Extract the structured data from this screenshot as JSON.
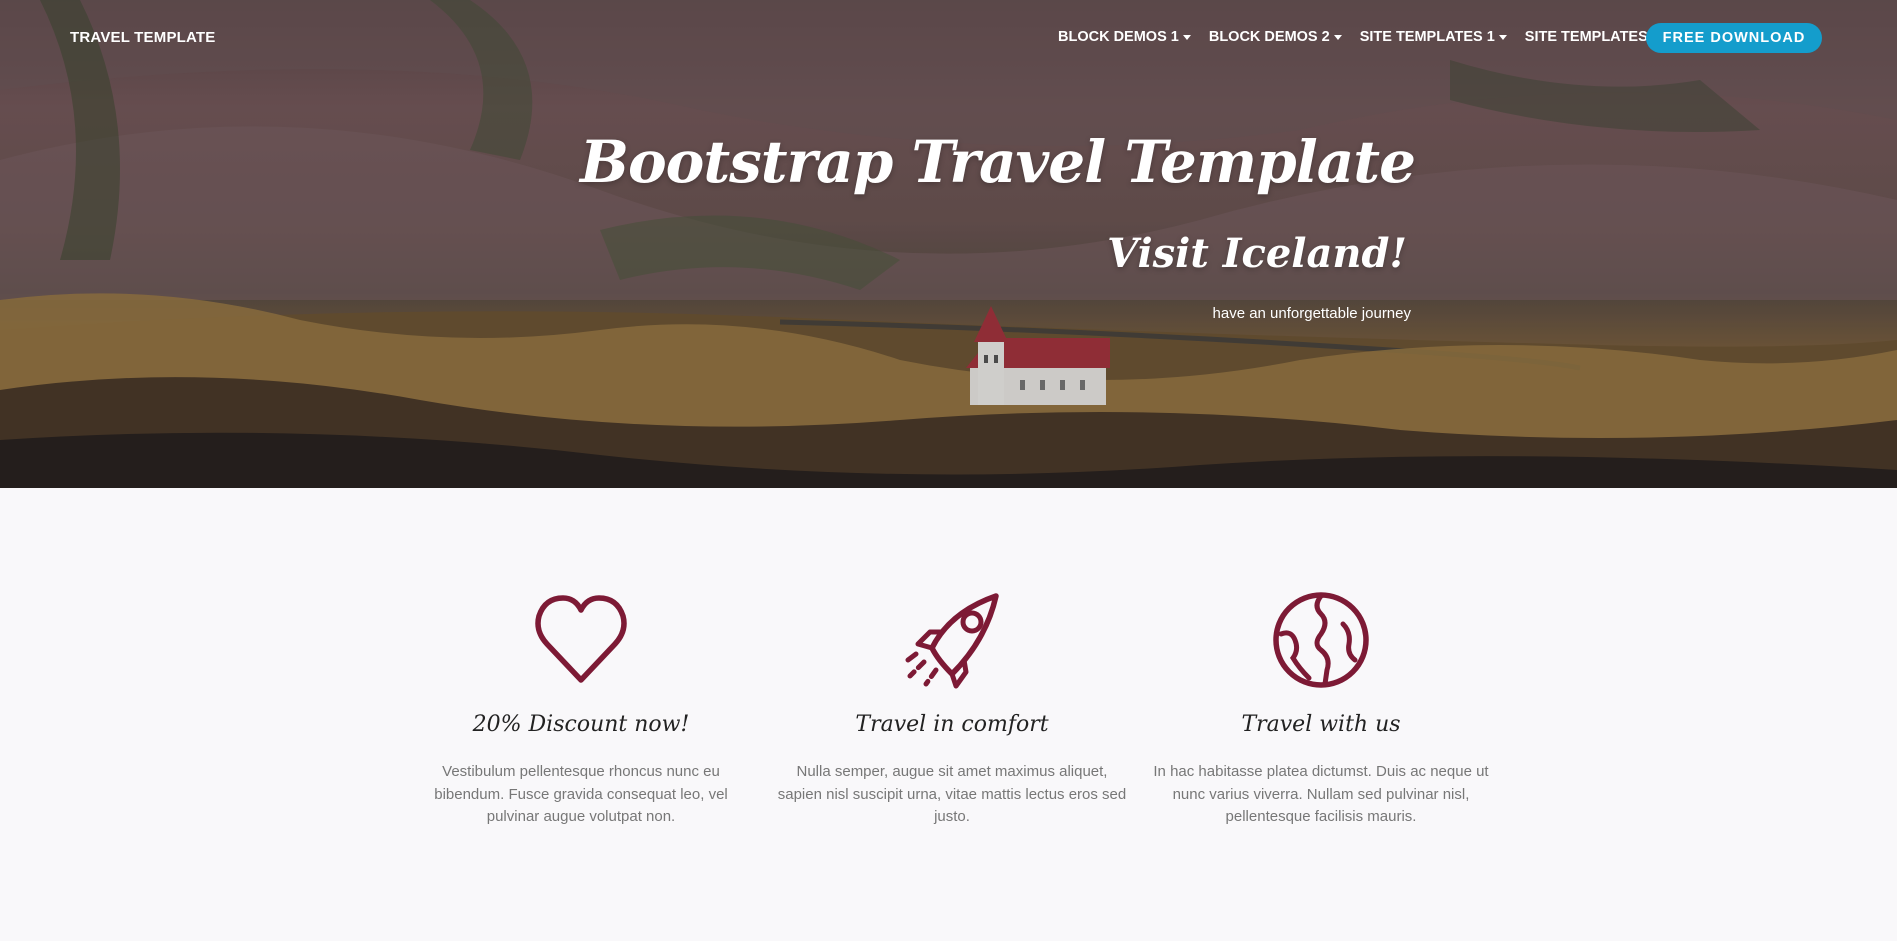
{
  "navbar": {
    "brand": "TRAVEL TEMPLATE",
    "items": [
      {
        "label": "BLOCK DEMOS 1"
      },
      {
        "label": "BLOCK DEMOS 2"
      },
      {
        "label": "SITE TEMPLATES 1"
      },
      {
        "label": "SITE TEMPLATES 2"
      }
    ],
    "cta_label": "FREE DOWNLOAD"
  },
  "hero": {
    "title": "Bootstrap Travel Template",
    "subtitle": "Visit Iceland!",
    "tagline": "have an unforgettable journey"
  },
  "features": [
    {
      "icon": "heart-icon",
      "title": "20% Discount now!",
      "text": "Vestibulum pellentesque rhoncus nunc eu bibendum. Fusce gravida consequat leo, vel pulvinar augue volutpat non."
    },
    {
      "icon": "rocket-icon",
      "title": "Travel in comfort",
      "text": "Nulla semper, augue sit amet maximus aliquet, sapien nisl suscipit urna, vitae mattis lectus eros sed justo."
    },
    {
      "icon": "globe-icon",
      "title": "Travel with us",
      "text": "In hac habitasse platea dictumst. Duis ac neque ut nunc varius viverra. Nullam sed pulvinar nisl, pellentesque facilisis mauris."
    }
  ],
  "colors": {
    "accent": "#149dcc",
    "icon": "#7d1a35",
    "page_background": "#f9f8fa"
  }
}
